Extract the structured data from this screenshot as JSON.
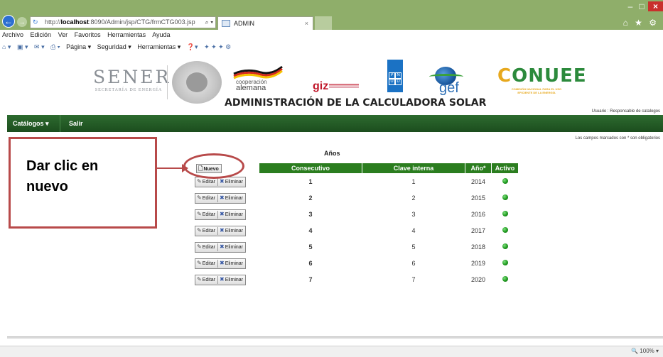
{
  "browser": {
    "url_prefix": "http://",
    "url_host": "localhost",
    "url_rest": ":8090/Admin/jsp/CTG/frmCTG003.jsp",
    "url_tools": "⌕ ▾",
    "tab_title": "ADMIN",
    "tab_close": "×",
    "window_min": "–",
    "window_max": "□",
    "window_close": "×",
    "back": "←",
    "forward": "→",
    "right_icons": "⌂ ★ ⚙",
    "zoom": "🔍 100%  ▾"
  },
  "menu": [
    "Archivo",
    "Edición",
    "Ver",
    "Favoritos",
    "Herramientas",
    "Ayuda"
  ],
  "command_bar": {
    "pagina": "Página ▾",
    "seguridad": "Seguridad ▾",
    "herramientas": "Herramientas ▾"
  },
  "header": {
    "sener": "SENER",
    "sener_sub": "SECRETARÍA DE ENERGÍA",
    "coop_line1": "cooperación",
    "coop_line2": "alemana",
    "giz": "giz",
    "undp": [
      "P",
      "N",
      "U",
      "D"
    ],
    "gef": "gef",
    "conuee_first": "C",
    "conuee_rest": "ONUEE",
    "conuee_sub": "COMISIÓN NACIONAL PARA EL USO EFICIENTE DE LA ENERGÍA",
    "title": "ADMINISTRACIÓN DE LA CALCULADORA SOLAR",
    "user": "Usuario : Responsable de catalogos"
  },
  "nav": {
    "catalogos": "Catálogos ▾",
    "salir": "Salir"
  },
  "required_note": "Los campos marcados con * son obligatorios",
  "table": {
    "caption": "Años",
    "new_label": "Nuevo",
    "headers": [
      "Consecutivo",
      "Clave interna",
      "Año*",
      "Activo"
    ],
    "edit_label": "Editar",
    "delete_label": "Eliminar",
    "rows": [
      {
        "consecutivo": "1",
        "clave": "1",
        "anio": "2014"
      },
      {
        "consecutivo": "2",
        "clave": "2",
        "anio": "2015"
      },
      {
        "consecutivo": "3",
        "clave": "3",
        "anio": "2016"
      },
      {
        "consecutivo": "4",
        "clave": "4",
        "anio": "2017"
      },
      {
        "consecutivo": "5",
        "clave": "5",
        "anio": "2018"
      },
      {
        "consecutivo": "6",
        "clave": "6",
        "anio": "2019"
      },
      {
        "consecutivo": "7",
        "clave": "7",
        "anio": "2020"
      }
    ]
  },
  "callout": {
    "line1": "Dar clic en",
    "line2": "nuevo"
  },
  "colors": {
    "brand_green": "#2b7d1f",
    "nav_green": "#1c4d1e",
    "annotation_red": "#b84a4a",
    "chrome_green": "#8fae6a"
  }
}
